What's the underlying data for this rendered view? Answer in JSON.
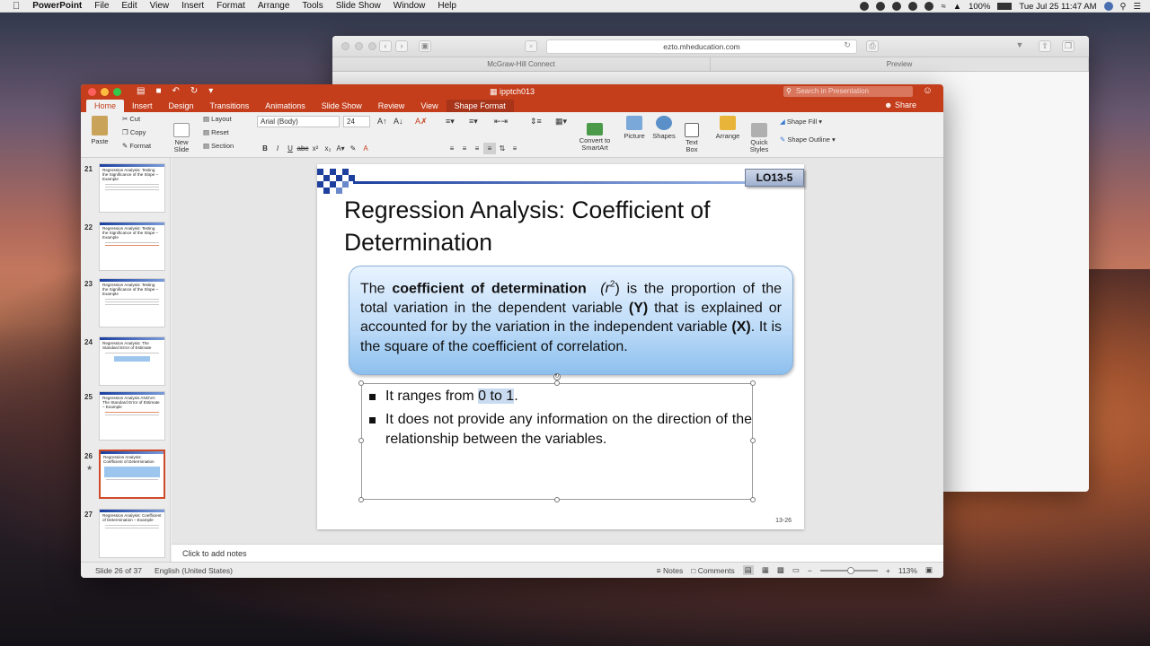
{
  "menubar": {
    "apple": "",
    "app": "PowerPoint",
    "items": [
      "File",
      "Edit",
      "View",
      "Insert",
      "Format",
      "Arrange",
      "Tools",
      "Slide Show",
      "Window",
      "Help"
    ],
    "battery": "100%",
    "clock": "Tue Jul 25  11:47 AM"
  },
  "safari": {
    "url": "ezto.mheducation.com",
    "tabs": [
      "McGraw-Hill Connect",
      "Preview"
    ]
  },
  "ppt": {
    "doc_title": "ipptch013",
    "search_placeholder": "Search in Presentation",
    "tabs": [
      "Home",
      "Insert",
      "Design",
      "Transitions",
      "Animations",
      "Slide Show",
      "Review",
      "View",
      "Shape Format"
    ],
    "active_tab": "Home",
    "share": "Share",
    "ribbon": {
      "paste": "Paste",
      "cut": "Cut",
      "copy": "Copy",
      "format": "Format",
      "new_slide": "New\nSlide",
      "layout": "Layout",
      "reset": "Reset",
      "section": "Section",
      "font": "Arial (Body)",
      "size": "24",
      "convert": "Convert to\nSmartArt",
      "picture": "Picture",
      "shapes": "Shapes",
      "textbox": "Text\nBox",
      "arrange": "Arrange",
      "quick": "Quick\nStyles",
      "shape_fill": "Shape Fill",
      "shape_outline": "Shape Outline"
    },
    "thumbnails": [
      {
        "num": "21",
        "title": "Regression Analysis: Testing the Significance of the Slope – Example"
      },
      {
        "num": "22",
        "title": "Regression Analysis: Testing the Significance of the Slope – Example"
      },
      {
        "num": "23",
        "title": "Regression Analysis: Testing the Significance of the Slope – Example"
      },
      {
        "num": "24",
        "title": "Regression Analysis: The Standard Error of Estimate"
      },
      {
        "num": "25",
        "title": "Regression Analysis ANOVA: The Standard Error of Estimate – Example"
      },
      {
        "num": "26",
        "title": "Regression Analysis: Coefficient of Determination"
      },
      {
        "num": "27",
        "title": "Regression Analysis: Coefficient of Determination – Example"
      }
    ],
    "slide": {
      "lo": "LO13-5",
      "title": "Regression Analysis: Coefficient of Determination",
      "def_pre": "The ",
      "def_bold": "coefficient of determination",
      "def_r": "(r",
      "def_sup": "2",
      "def_mid": ") is the proportion of the total variation in the dependent variable ",
      "def_y": "(Y)",
      "def_mid2": " that is explained or accounted for by the variation in the independent variable ",
      "def_x": "(X)",
      "def_end": ". It is the square of the coefficient of correlation.",
      "b1_pre": "It ranges from ",
      "b1_hl": "0 to 1",
      "b1_end": ".",
      "b2": "It does not provide any information on the direction of the relationship between the variables.",
      "page": "13-26"
    },
    "notes_placeholder": "Click to add notes",
    "status": {
      "slide": "Slide 26 of 37",
      "lang": "English (United States)",
      "notes": "Notes",
      "comments": "Comments",
      "zoom": "113%"
    }
  }
}
